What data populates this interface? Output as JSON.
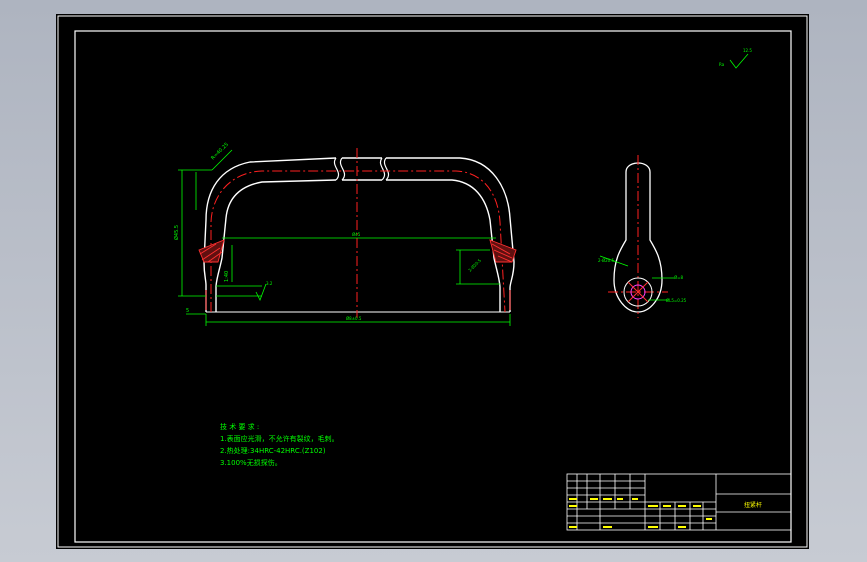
{
  "drawing": {
    "roughness_main": "12.5",
    "roughness_main_prefix": "Ra",
    "roughness_local": "3.2",
    "dims": {
      "bend_radius": "R=40.25",
      "height": "Ø45.5",
      "top_length": "Ø45",
      "angle_callout": "1:40",
      "overall_length": "Ø8±0.5",
      "base_gap": "5",
      "side_label_a": "2-Ø20.5",
      "side_label_b": "Ø=8",
      "side_label_c": "ØL5=0.25"
    },
    "notes": {
      "heading": "技 术 要 求 :",
      "line1": "1.表面应光滑，不允许有裂纹，毛刺。",
      "line2": "2.热处理:34HRC-42HRC.(Z102)",
      "line3": "3.100%无损探伤。"
    },
    "title_block": {
      "part_name": "扭紧杆",
      "scale": "1:1",
      "sheet": "共 张"
    }
  },
  "colors": {
    "canvas": "#000000",
    "outline": "#ffffff",
    "dimension": "#00ff00",
    "centerline": "#ff2020",
    "hatch": "#ff2020",
    "text": "#00ff00",
    "grid_text": "#ffff00"
  }
}
